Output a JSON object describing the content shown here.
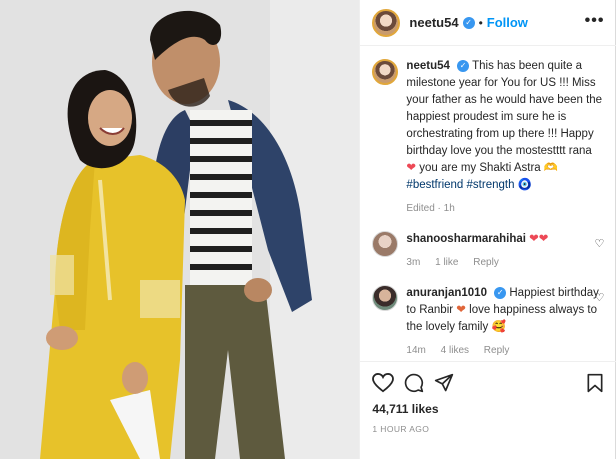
{
  "post": {
    "author": "neetu54",
    "follow_label": "Follow",
    "more_label": "•••",
    "caption": {
      "user": "neetu54",
      "text": "This has been quite a milestone year for You for US !!! Miss your father as he would have been the happiest proudest im sure he is orchestrating from up there !!! Happy birthday love you the mostestttt rana",
      "text2": "you are my Shakti Astra",
      "glyph": "🫶",
      "tags": [
        "#bestfriend",
        "#strength"
      ],
      "edited": "Edited · 1h"
    },
    "comments": [
      {
        "user": "shanoosharmarahihai",
        "text": "",
        "age": "3m",
        "likes": "1 like",
        "reply": "Reply"
      },
      {
        "user": "anuranjan1010",
        "text": "Happiest birthday to Ranbir",
        "text2": "love happiness always to the lovely family",
        "age": "14m",
        "likes": "4 likes",
        "reply": "Reply"
      }
    ],
    "like_count": "44,711 likes",
    "timestamp": "1 HOUR AGO"
  },
  "colors": {
    "accent": "#0095f6",
    "heart": "#ed4956",
    "verified": "#3897f0",
    "hashtag": "#00376b",
    "muted": "#8e8e8e"
  },
  "icons": [
    "heart-icon",
    "comment-icon",
    "share-icon",
    "bookmark-icon",
    "verified-icon",
    "nazar-icon"
  ]
}
